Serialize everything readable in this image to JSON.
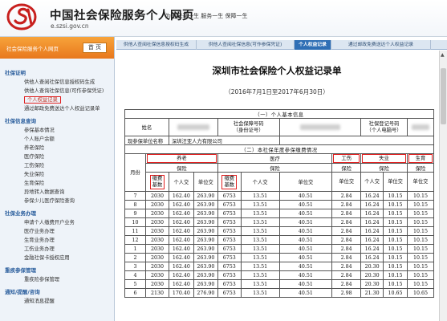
{
  "header": {
    "site_name": "中国社会保险服务个人网页",
    "site_url": "e.szsi.gov.cn",
    "motto": "为您记录一生  服务一生  保障一生"
  },
  "sidebar": {
    "top_label": "社会保险服务个人网页",
    "home_label": "首 页",
    "groups": [
      {
        "title": "社保证明",
        "items": [
          "供他人查阅社保信息授权码生成",
          "供他人查询社保信息(可作参保凭证)",
          "个人权益记录",
          "通过邮政免费送达个人权益记录单"
        ]
      },
      {
        "title": "社保信息查询",
        "items": [
          "参保基本情况",
          "个人账户余额",
          "养老保险",
          "医疗保险",
          "工伤保险",
          "失业保险",
          "生育保险",
          "异地转入数据查询",
          "参保少儿医疗保险查询"
        ]
      },
      {
        "title": "社保业务办理",
        "items": [
          "申请个人缴费开户业务",
          "医疗业务办理",
          "生育业务办理",
          "工伤业务办理",
          "金融社保卡授权应用"
        ]
      },
      {
        "title": "重疾参保管理",
        "items": [
          "重疾险参保管理"
        ]
      },
      {
        "title": "通知/提醒/咨询",
        "items": [
          "通知消息提醒"
        ]
      }
    ]
  },
  "tabs": [
    "供他人查阅社保信息授权码生成",
    "供他人查阅社保信息(可作参保凭证)",
    "个人权益记录",
    "通过邮政免费送达个人权益记录"
  ],
  "active_tab": 2,
  "document": {
    "title": "深圳市社会保险个人权益记录单",
    "period": "（2016年7月1日至2017年6月30日）",
    "section1": "（一）个人基本信息",
    "section2": "（二）本社保年度参保缴费情况",
    "name_label": "姓名",
    "si_number_label": "社会保障号码\n（身份证号）",
    "computer_number_label": "社保登记号码\n（个人电脑号）",
    "employer_label": "现参保单位名称",
    "employer_value": "深圳汪亚人力有限公司",
    "month_label": "月份",
    "pension": "养老",
    "medical": "医疗",
    "injury": "工伤",
    "unemployment": "失业",
    "maternity": "生育",
    "insurance": "保险",
    "base": "缴费\n基数",
    "personal": "个人交",
    "employer": "单位交",
    "unit_pay": "单位交",
    "personal_short": "个人交",
    "rows": [
      [
        "7",
        "2030",
        "162.40",
        "263.90",
        "6753",
        "13.51",
        "40.51",
        "2.84",
        "16.24",
        "10.15",
        "10.15"
      ],
      [
        "8",
        "2030",
        "162.40",
        "263.90",
        "6753",
        "13.51",
        "40.51",
        "2.84",
        "16.24",
        "10.15",
        "10.15"
      ],
      [
        "9",
        "2030",
        "162.40",
        "263.90",
        "6753",
        "13.51",
        "40.51",
        "2.84",
        "16.24",
        "10.15",
        "10.15"
      ],
      [
        "10",
        "2030",
        "162.40",
        "263.90",
        "6753",
        "13.51",
        "40.51",
        "2.84",
        "16.24",
        "10.15",
        "10.15"
      ],
      [
        "11",
        "2030",
        "162.40",
        "263.90",
        "6753",
        "13.51",
        "40.51",
        "2.84",
        "16.24",
        "10.15",
        "10.15"
      ],
      [
        "12",
        "2030",
        "162.40",
        "263.90",
        "6753",
        "13.51",
        "40.51",
        "2.84",
        "16.24",
        "10.15",
        "10.15"
      ],
      [
        "1",
        "2030",
        "162.40",
        "263.90",
        "6753",
        "13.51",
        "40.51",
        "2.84",
        "16.24",
        "10.15",
        "10.15"
      ],
      [
        "2",
        "2030",
        "162.40",
        "263.90",
        "6753",
        "13.51",
        "40.51",
        "2.84",
        "16.24",
        "10.15",
        "10.15"
      ],
      [
        "3",
        "2030",
        "162.40",
        "263.90",
        "6753",
        "13.51",
        "40.51",
        "2.84",
        "20.30",
        "10.15",
        "10.15"
      ],
      [
        "4",
        "2030",
        "162.40",
        "263.90",
        "6753",
        "13.51",
        "40.51",
        "2.84",
        "20.30",
        "10.15",
        "10.15"
      ],
      [
        "5",
        "2030",
        "162.40",
        "263.90",
        "6753",
        "13.51",
        "40.51",
        "2.84",
        "20.30",
        "10.15",
        "10.15"
      ],
      [
        "6",
        "2130",
        "170.40",
        "276.90",
        "6753",
        "13.51",
        "40.51",
        "2.98",
        "21.30",
        "10.65",
        "10.65"
      ]
    ]
  },
  "colors": {
    "accent_orange": "#f08a24",
    "tab_active": "#2f6fb5",
    "highlight_red": "#e02020"
  }
}
